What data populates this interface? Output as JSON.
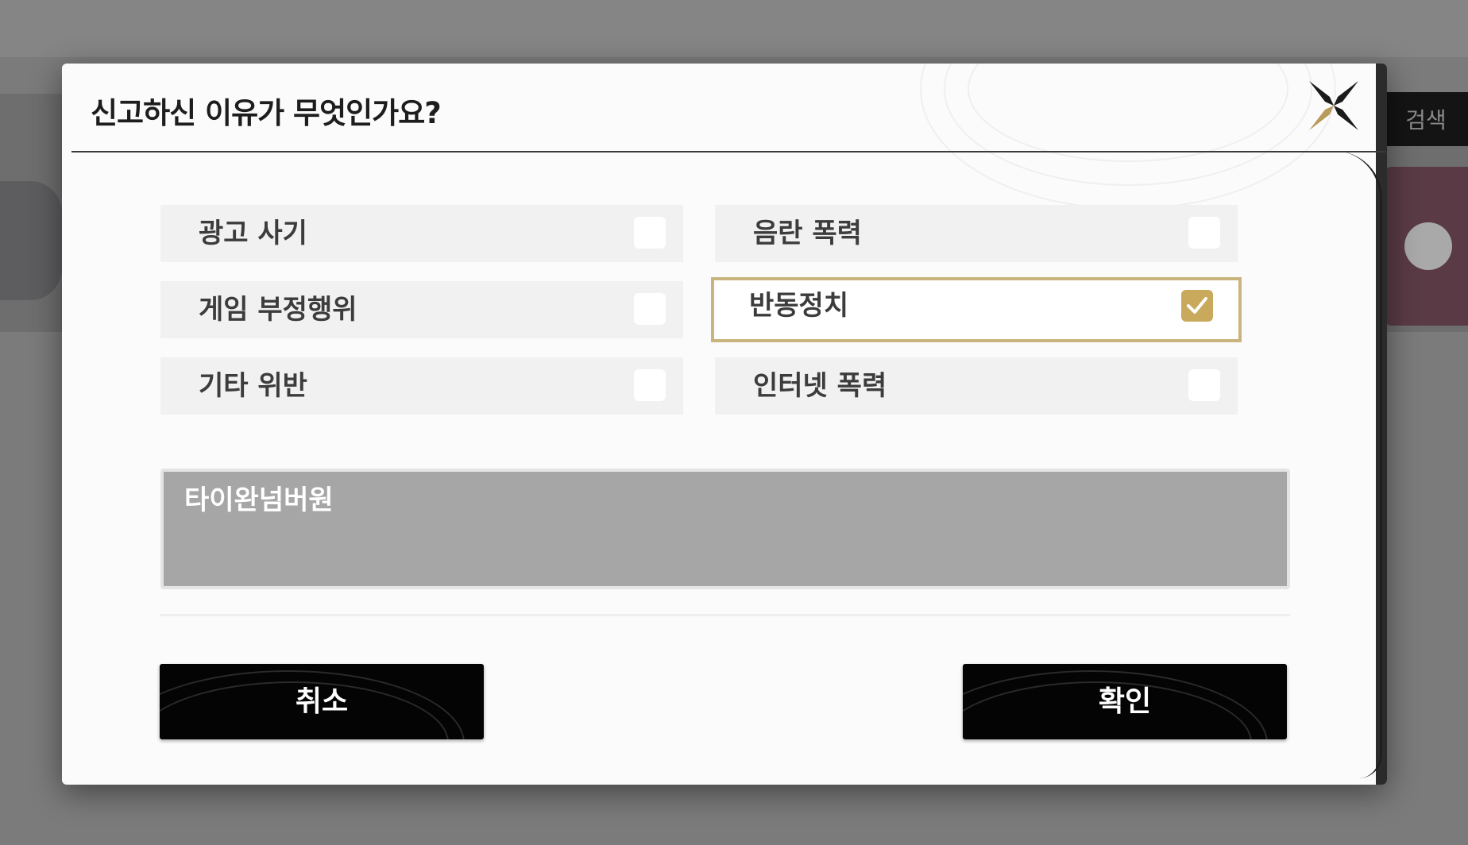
{
  "background": {
    "right_button_label": "검색"
  },
  "dialog": {
    "title": "신고하신 이유가 무엇인가요?",
    "close_icon": "close-x-icon",
    "accent_color": "#c9b47f",
    "checkbox_checked_color": "#c9a95c",
    "options": [
      {
        "label": "광고 사기",
        "checked": false
      },
      {
        "label": "음란 폭력",
        "checked": false
      },
      {
        "label": "게임 부정행위",
        "checked": false
      },
      {
        "label": "반동정치",
        "checked": true
      },
      {
        "label": "기타 위반",
        "checked": false
      },
      {
        "label": "인터넷 폭력",
        "checked": false
      }
    ],
    "reason_text": "타이완넘버원",
    "buttons": {
      "cancel_label": "취소",
      "confirm_label": "확인"
    }
  }
}
